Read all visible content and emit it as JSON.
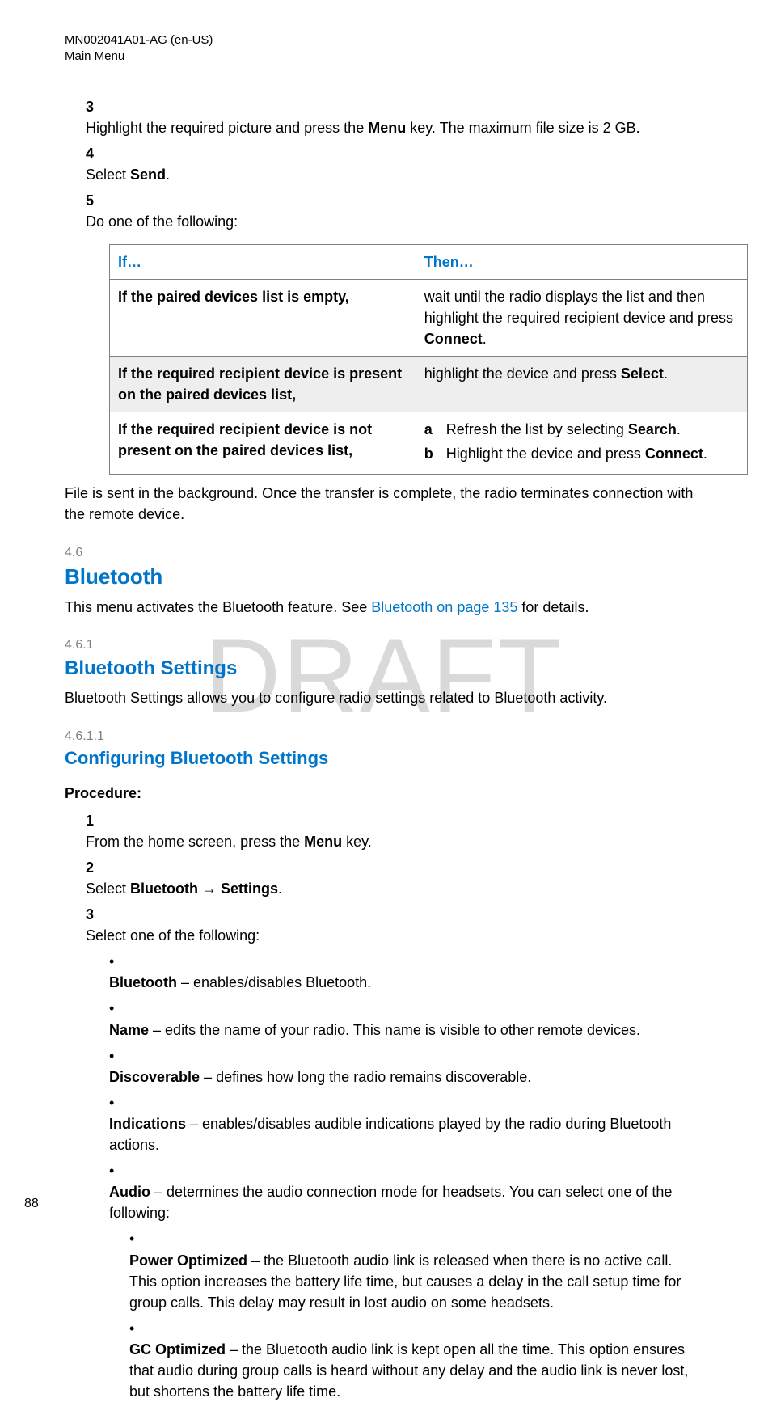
{
  "header": {
    "doc_id": "MN002041A01-AG (en-US)",
    "section": "Main Menu"
  },
  "watermark": "DRAFT",
  "steps_top": [
    {
      "num": "3",
      "pre": "Highlight the required picture and press the ",
      "bold1": "Menu",
      "post": " key. The maximum file size is 2 GB."
    },
    {
      "num": "4",
      "pre": "Select ",
      "bold1": "Send",
      "post": "."
    },
    {
      "num": "5",
      "pre": "Do one of the following:",
      "bold1": "",
      "post": ""
    }
  ],
  "table": {
    "head_if": "If…",
    "head_then": "Then…",
    "rows": [
      {
        "if_bold": "If the paired devices list is empty,",
        "then_pre": "wait until the radio displays the list and then highlight the required recipient device and press ",
        "then_bold": "Connect",
        "then_post": "."
      },
      {
        "if_bold": "If the required recipient device is present on the paired devices list,",
        "then_pre": "highlight the device and press ",
        "then_bold": "Select",
        "then_post": ".",
        "shade": true
      },
      {
        "if_bold": "If the required recipient device is not present on the paired devices list,",
        "sub": [
          {
            "lbl": "a",
            "pre": "Refresh the list by selecting ",
            "bold": "Search",
            "post": "."
          },
          {
            "lbl": "b",
            "pre": "Highlight the device and press ",
            "bold": "Connect",
            "post": "."
          }
        ]
      }
    ]
  },
  "after_table": "File is sent in the background. Once the transfer is complete, the radio terminates connection with the remote device.",
  "sec46": {
    "num": "4.6",
    "title": "Bluetooth",
    "para_pre": "This menu activates the Bluetooth feature. See ",
    "para_link": "Bluetooth on page 135",
    "para_post": " for details."
  },
  "sec461": {
    "num": "4.6.1",
    "title": "Bluetooth Settings",
    "para": "Bluetooth Settings allows you to configure radio settings related to Bluetooth activity."
  },
  "sec4611": {
    "num": "4.6.1.1",
    "title": "Configuring Bluetooth Settings",
    "proc_label": "Procedure:",
    "steps": [
      {
        "num": "1",
        "pre": "From the home screen, press the ",
        "bold1": "Menu",
        "post": " key."
      },
      {
        "num": "2",
        "pre": "Select ",
        "bold1": "Bluetooth",
        "mid": " → ",
        "bold2": "Settings",
        "post": "."
      },
      {
        "num": "3",
        "pre": "Select one of the following:",
        "bold1": "",
        "post": ""
      }
    ],
    "bullets": [
      {
        "bold": "Bluetooth",
        "text": " – enables/disables Bluetooth."
      },
      {
        "bold": "Name",
        "text": " – edits the name of your radio. This name is visible to other remote devices."
      },
      {
        "bold": "Discoverable",
        "text": " – defines how long the radio remains discoverable."
      },
      {
        "bold": "Indications",
        "text": " – enables/disables audible indications played by the radio during Bluetooth actions."
      },
      {
        "bold": "Audio",
        "text": " – determines the audio connection mode for headsets. You can select one of the following:"
      }
    ],
    "sub_bullets": [
      {
        "bold": "Power Optimized",
        "text": " – the Bluetooth audio link is released when there is no active call. This option increases the battery life time, but causes a delay in the call setup time for group calls. This delay may result in lost audio on some headsets."
      },
      {
        "bold": "GC Optimized",
        "text": " – the Bluetooth audio link is kept open all the time. This option ensures that audio during group calls is heard without any delay and the audio link is never lost, but shortens the battery life time."
      }
    ]
  },
  "page_number": "88"
}
